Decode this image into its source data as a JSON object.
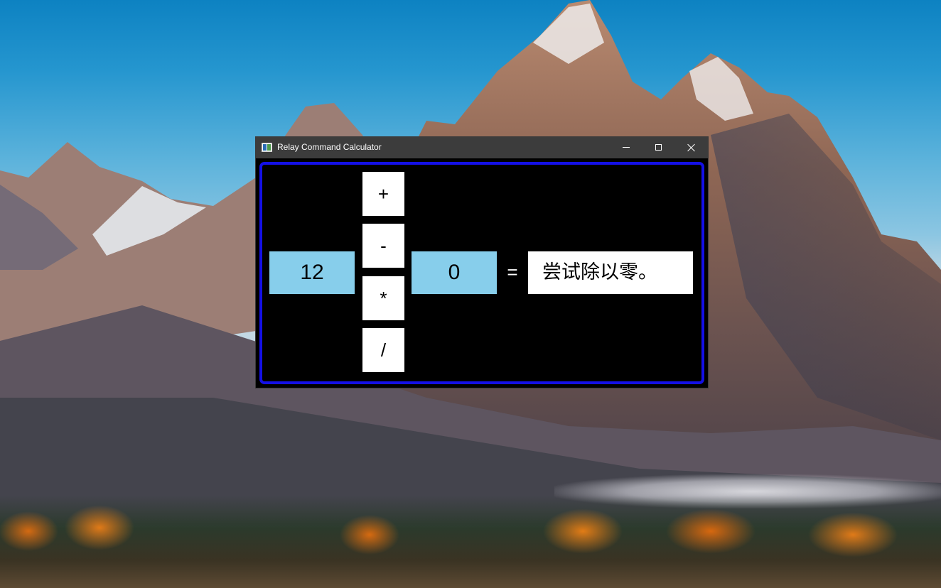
{
  "window": {
    "title": "Relay Command Calculator",
    "icon": "app-window-icon"
  },
  "titlebar_buttons": {
    "minimize": "minimize-icon",
    "maximize": "maximize-icon",
    "close": "close-icon"
  },
  "calculator": {
    "operand_a": "12",
    "operand_b": "0",
    "operators": {
      "plus": "+",
      "minus": "-",
      "multiply": "*",
      "divide": "/"
    },
    "equals": "=",
    "result": "尝试除以零。"
  },
  "colors": {
    "client_border": "#1410e6",
    "operand_background": "#87ceeb",
    "titlebar_background": "#3c3c3c",
    "client_background": "#000000"
  }
}
